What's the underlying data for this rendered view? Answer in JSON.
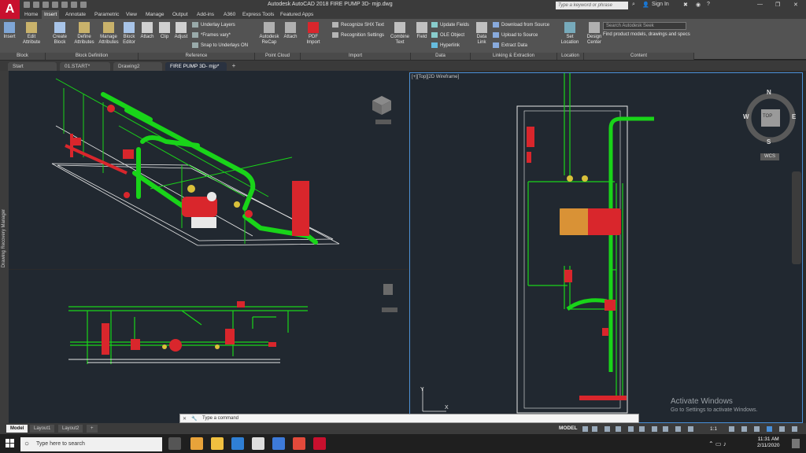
{
  "window": {
    "title": "Autodesk AutoCAD 2018   FIRE PUMP 3D- mjp.dwg",
    "search_placeholder": "Type a keyword or phrase",
    "sign_in": "Sign In"
  },
  "ribbon_tabs": [
    "Home",
    "Insert",
    "Annotate",
    "Parametric",
    "View",
    "Manage",
    "Output",
    "Add-ins",
    "A360",
    "Express Tools",
    "Featured Apps"
  ],
  "active_tab": "Insert",
  "ribbon": {
    "insert": "Insert",
    "edit_attribute": "Edit Attribute",
    "create_block": "Create Block",
    "define_attributes": "Define Attributes",
    "manage_attributes": "Manage Attributes",
    "block_editor": "Block Editor",
    "attach": "Attach",
    "clip": "Clip",
    "adjust": "Adjust",
    "underlay_layers": "Underlay Layers",
    "frames_vary": "*Frames vary*",
    "snap_underlays": "Snap to Underlays ON",
    "autodesk_recap": "Autodesk ReCap",
    "attach2": "Attach",
    "pdf_import": "PDF Import",
    "recognize_shx": "Recognize SHX Text",
    "recognition_settings": "Recognition Settings",
    "combine_text": "Combine Text",
    "field": "Field",
    "update_fields": "Update Fields",
    "ole_object": "OLE Object",
    "hyperlink": "Hyperlink",
    "data_link": "Data Link",
    "download_source": "Download from Source",
    "upload_source": "Upload to Source",
    "extract_data": "Extract  Data",
    "set_location": "Set Location",
    "design_center": "Design Center",
    "seek_placeholder": "Search Autodesk Seek",
    "find_models": "Find product models, drawings and specs"
  },
  "panels": [
    "Block",
    "Block Definition",
    "Reference",
    "Point Cloud",
    "Import",
    "Data",
    "Linking & Extraction",
    "Location",
    "Content"
  ],
  "doc_tabs": [
    "Start",
    "01.START*",
    "Drawing2",
    "FIRE PUMP 3D- mjp*"
  ],
  "active_doc": "FIRE PUMP 3D- mjp*",
  "viewport_c_label": "[+][Top][2D Wireframe]",
  "viewcube": {
    "top": "TOP",
    "n": "N",
    "s": "S",
    "e": "E",
    "w": "W",
    "wcs": "WCS"
  },
  "side_panel": "Drawing Recovery Manager",
  "command_prompt": "Type a command",
  "layout_tabs": [
    "Model",
    "Layout1",
    "Layout2"
  ],
  "status": {
    "model": "MODEL",
    "scale": "1:1"
  },
  "activate": {
    "line1": "Activate Windows",
    "line2": "Go to Settings to activate Windows."
  },
  "taskbar": {
    "search": "Type here to search",
    "time": "11:31 AM",
    "date": "2/11/2020"
  },
  "colors": {
    "pipe": "#19d419",
    "equip": "#d9262c",
    "outline": "#e8e8e8",
    "accent": "#4a90d9"
  }
}
